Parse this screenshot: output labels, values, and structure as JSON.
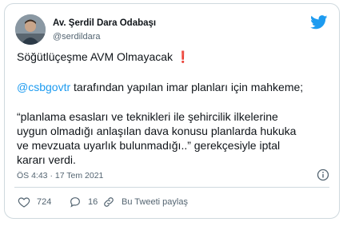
{
  "author": {
    "name": "Av. Şerdil Dara Odabaşı",
    "handle": "@serdildara"
  },
  "tweet": {
    "line1": "Söğütlüçeşme AVM Olmayacak",
    "line1_emoji": "❗",
    "mention": "@csbgovtr",
    "line2_rest": " tarafından yapılan imar planları için mahkeme;",
    "line3": "“planlama esasları ve teknikleri ile şehircilik ilkelerine",
    "line4": "uygun olmadığı anlaşılan dava konusu planlarda hukuka",
    "line5": "ve mevzuata uyarlık bulunmadığı..” gerekçesiyle iptal",
    "line6": "kararı verdi."
  },
  "timestamp": "ÖS 4:43 · 17 Tem 2021",
  "actions": {
    "like_count": "724",
    "reply_count": "16",
    "share_label": "Bu Tweeti paylaş"
  },
  "colors": {
    "accent": "#1d9bf0",
    "text": "#0f1419",
    "muted": "#536471",
    "border": "#cfd9de"
  },
  "icons": [
    "avatar",
    "twitter-bird-icon",
    "info-icon",
    "heart-icon",
    "reply-icon",
    "link-icon"
  ]
}
